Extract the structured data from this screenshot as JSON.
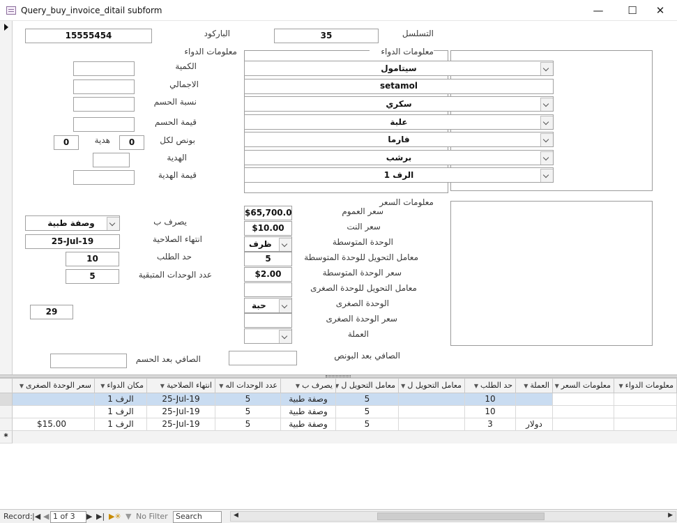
{
  "window": {
    "title": "Query_buy_invoice_ditail subform"
  },
  "form": {
    "labels": {
      "barcode": "الباركود",
      "serial": "التسلسل",
      "drug_info_left": "معلومات الدواء",
      "drug_info_group": "معلومات الدواء",
      "quantity": "الكمية",
      "total": "الاجمالي",
      "discount_pct": "نسبة الحسم",
      "discount_value": "قيمة الحسم",
      "bonus_per": "بونص لكل",
      "gift": "هدية",
      "gift2": "الهدية",
      "gift_value": "قيمة الهدية",
      "price_info": "معلومات السعر",
      "public_price": "سعر العموم",
      "net_price": "سعر النت",
      "mid_unit": "الوحدة المتوسطة",
      "mid_conv": "معامل التحويل للوحدة المتوسطة",
      "mid_price": "سعر الوحدة المتوسطة",
      "small_conv": "معامل التحويل للوحدة الصغرى",
      "small_unit": "الوحدة الصغرى",
      "small_price": "سعر الوحدة الصغرى",
      "currency": "العملة",
      "dispensed_by": "يصرف ب",
      "expiry": "انتهاء الصلاحية",
      "order_limit": "حد الطلب",
      "remaining_units": "عدد الوحدات المتبقية",
      "net_after_bonus": "الصافي بعد البونص",
      "net_after_discount": "الصافي بعد الحسم"
    },
    "values": {
      "barcode": "15555454",
      "serial": "35",
      "drug_name": "سيتامول",
      "sci_name": "setamol",
      "form": "سكري",
      "package": "علبة",
      "company": "فارما",
      "type": "برشب",
      "shelf": "الرف 1",
      "quantity": "",
      "total": "",
      "discount_pct": "",
      "discount_value": "",
      "bonus_per": "0",
      "gift": "0",
      "gift2": "",
      "gift_value": "",
      "public_price": "$65,700.00",
      "net_price": "$10.00",
      "mid_unit": "ظرف",
      "mid_conv": "5",
      "mid_price": "$2.00",
      "small_conv": "",
      "small_unit": "حبة",
      "small_price": "",
      "currency": "",
      "dispensed_by": "وصفة طبية",
      "expiry": "25-Jul-19",
      "order_limit": "10",
      "remaining_units": "5",
      "counter": "29",
      "net_after_bonus": "",
      "net_after_discount": ""
    }
  },
  "datasheet": {
    "columns": [
      "معلومات الدواء",
      "معلومات السعر",
      "العملة",
      "حد الطلب",
      "معامل التحويل ل",
      "معامل التحويل ل",
      "يصرف ب",
      "عدد الوحدات اله",
      "انتهاء الصلاحية",
      "مكان الدواء",
      "سعر الوحدة الصغرى"
    ],
    "rows": [
      [
        "",
        "",
        "",
        "10",
        "",
        "5",
        "وصفة طبية",
        "5",
        "25-Jul-19",
        "الرف 1",
        ""
      ],
      [
        "",
        "",
        "",
        "10",
        "",
        "5",
        "وصفة طبية",
        "5",
        "25-Jul-19",
        "الرف 1",
        ""
      ],
      [
        "",
        "",
        "دولار",
        "3",
        "",
        "5",
        "وصفة طبية",
        "5",
        "25-Jul-19",
        "الرف 1",
        "$15.00"
      ]
    ],
    "new_row_marker": "*"
  },
  "status": {
    "record_label": "Record:",
    "record_value": "1 of 3",
    "no_filter": "No Filter",
    "search": "Search"
  }
}
